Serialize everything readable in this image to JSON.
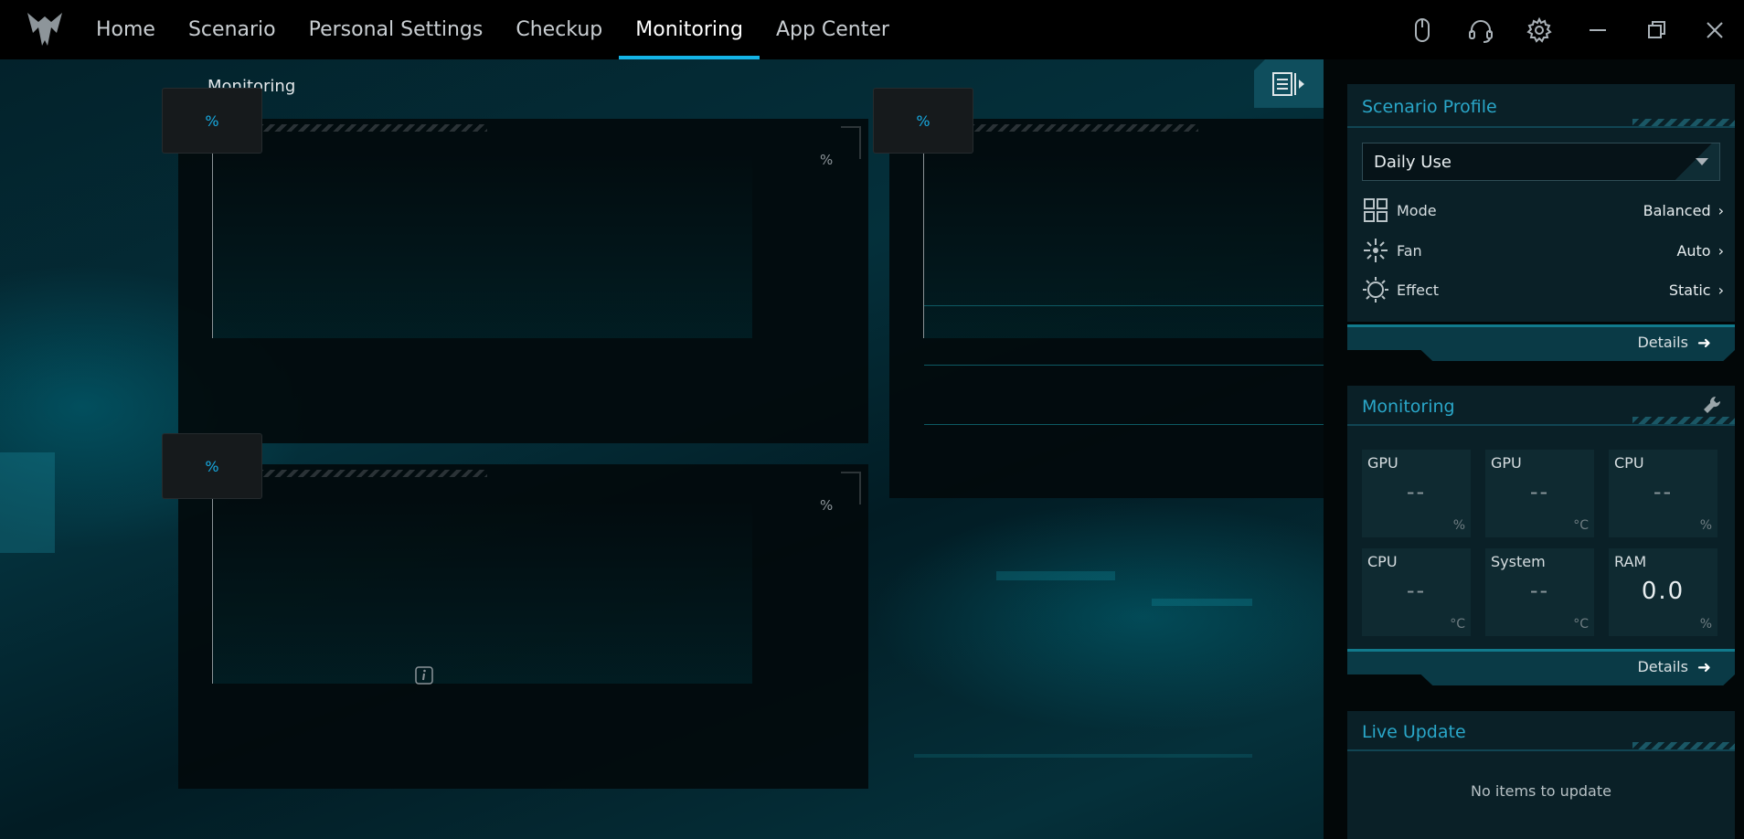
{
  "nav": {
    "items": [
      {
        "label": "Home",
        "active": false
      },
      {
        "label": "Scenario",
        "active": false
      },
      {
        "label": "Personal Settings",
        "active": false
      },
      {
        "label": "Checkup",
        "active": false
      },
      {
        "label": "Monitoring",
        "active": true
      },
      {
        "label": "App Center",
        "active": false
      }
    ],
    "accent_color": "#14b4e6"
  },
  "top_icons": [
    "mouse-icon",
    "headset-icon",
    "gear-icon",
    "minimize-icon",
    "restore-icon",
    "close-icon"
  ],
  "monitoring": {
    "title": "Monitoring",
    "panels": [
      {
        "tab_label": "%",
        "unit": "%"
      },
      {
        "tab_label": "%"
      },
      {
        "tab_label": "%",
        "unit": "%"
      }
    ]
  },
  "sidebar": {
    "scenario_profile": {
      "title": "Scenario Profile",
      "selected": "Daily Use",
      "rows": [
        {
          "icon": "grid-icon",
          "label": "Mode",
          "value": "Balanced"
        },
        {
          "icon": "fan-icon",
          "label": "Fan",
          "value": "Auto"
        },
        {
          "icon": "light-effect-icon",
          "label": "Effect",
          "value": "Static"
        }
      ],
      "details_label": "Details"
    },
    "monitoring": {
      "title": "Monitoring",
      "tiles": [
        {
          "label": "GPU",
          "value": "--",
          "unit": "%"
        },
        {
          "label": "GPU",
          "value": "--",
          "unit": "°C"
        },
        {
          "label": "CPU",
          "value": "--",
          "unit": "%"
        },
        {
          "label": "CPU",
          "value": "--",
          "unit": "°C"
        },
        {
          "label": "System",
          "value": "--",
          "unit": "°C"
        },
        {
          "label": "RAM",
          "value": "0.0",
          "unit": "%"
        }
      ],
      "details_label": "Details"
    },
    "live_update": {
      "title": "Live Update",
      "empty_text": "No items to update"
    }
  }
}
